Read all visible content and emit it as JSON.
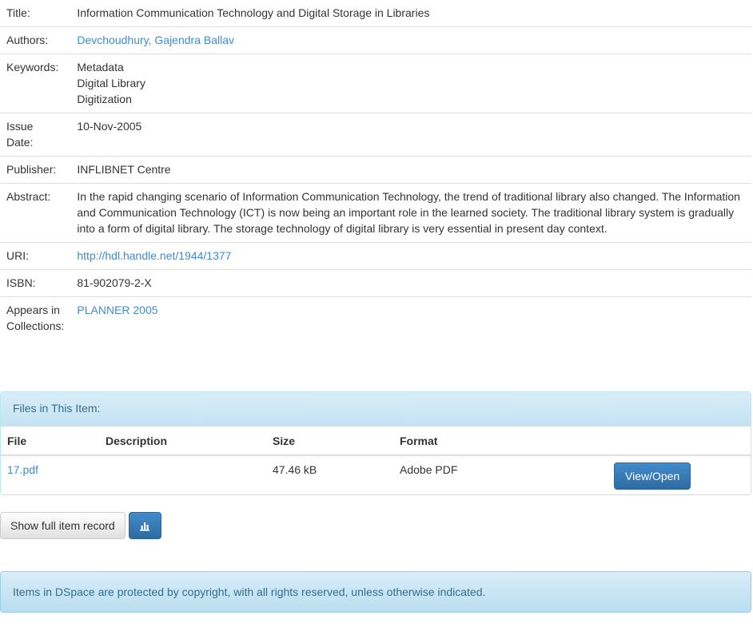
{
  "metadata": {
    "title": {
      "label": "Title:",
      "value": "Information Communication Technology and Digital Storage in Libraries"
    },
    "authors": {
      "label": "Authors:",
      "value": "Devchoudhury, Gajendra Ballav"
    },
    "keywords": {
      "label": "Keywords:",
      "values": [
        "Metadata",
        "Digital Library",
        "Digitization"
      ]
    },
    "issue_date": {
      "label_line1": "Issue",
      "label_line2": "Date:",
      "value": "10-Nov-2005"
    },
    "publisher": {
      "label": "Publisher:",
      "value": "INFLIBNET Centre"
    },
    "abstract": {
      "label": "Abstract:",
      "value": "In the rapid changing scenario of Information Communication Technology, the trend of traditional library also changed. The Information and Communication Technology (ICT) is now being an important role in the learned society. The traditional library system is gradually into a form of digital library. The storage technology of digital library is very essential in present day context."
    },
    "uri": {
      "label": "URI:",
      "value": "http://hdl.handle.net/1944/1377"
    },
    "isbn": {
      "label": "ISBN:",
      "value": "81-902079-2-X"
    },
    "collections": {
      "label_line1": "Appears in",
      "label_line2": "Collections:",
      "value": "PLANNER 2005"
    }
  },
  "files_panel": {
    "heading": "Files in This Item:",
    "columns": {
      "file": "File",
      "description": "Description",
      "size": "Size",
      "format": "Format"
    },
    "rows": [
      {
        "file": "17.pdf",
        "description": "",
        "size": "47.46 kB",
        "format": "Adobe PDF",
        "action": "View/Open"
      }
    ]
  },
  "actions": {
    "full_record_label": "Show full item record",
    "stats_icon": "bar-chart-icon"
  },
  "footer_notice": "Items in DSpace are protected by copyright, with all rights reserved, unless otherwise indicated."
}
